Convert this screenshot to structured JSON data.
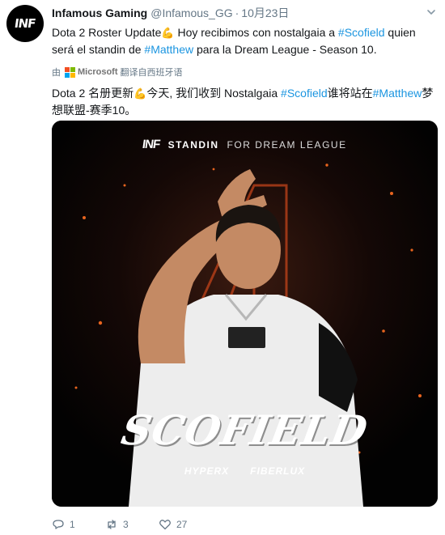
{
  "account": {
    "avatar_text": "INF",
    "name": "Infamous Gaming",
    "handle": "@Infamous_GG",
    "separator": "·",
    "date": "10月23日"
  },
  "tweet": {
    "part1": "Dota 2 Roster Update",
    "emoji": "💪",
    "part2": "  Hoy recibimos con nostalgaia a ",
    "hashtag1": "#Scofield",
    "part3": " quien será el standin de ",
    "hashtag2": "#Matthew",
    "part4": " para la Dream League - Season 10."
  },
  "translation_credit": {
    "prefix": "由",
    "brand": "Microsoft",
    "suffix": "翻译自西班牙语"
  },
  "translation": {
    "part1": "Dota 2 名册更新",
    "emoji": "💪",
    "part2": "今天, 我们收到 Nostalgaia ",
    "hashtag1": "#Scofield",
    "part3": "谁将站在",
    "hashtag2": "#Matthew",
    "part4": "梦想联盟-赛季10。"
  },
  "media": {
    "logo": "INF",
    "standin": "STANDIN",
    "for_line": "FOR DREAM LEAGUE",
    "player_name": "SCOFIELD",
    "sponsor1": "HYPERX",
    "sponsor2": "FIBERLUX"
  },
  "actions": {
    "replies": "1",
    "retweets": "3",
    "likes": "27"
  },
  "colors": {
    "link": "#1b95e0",
    "secondary_text": "#657786",
    "accent_orange": "#c2431a"
  }
}
